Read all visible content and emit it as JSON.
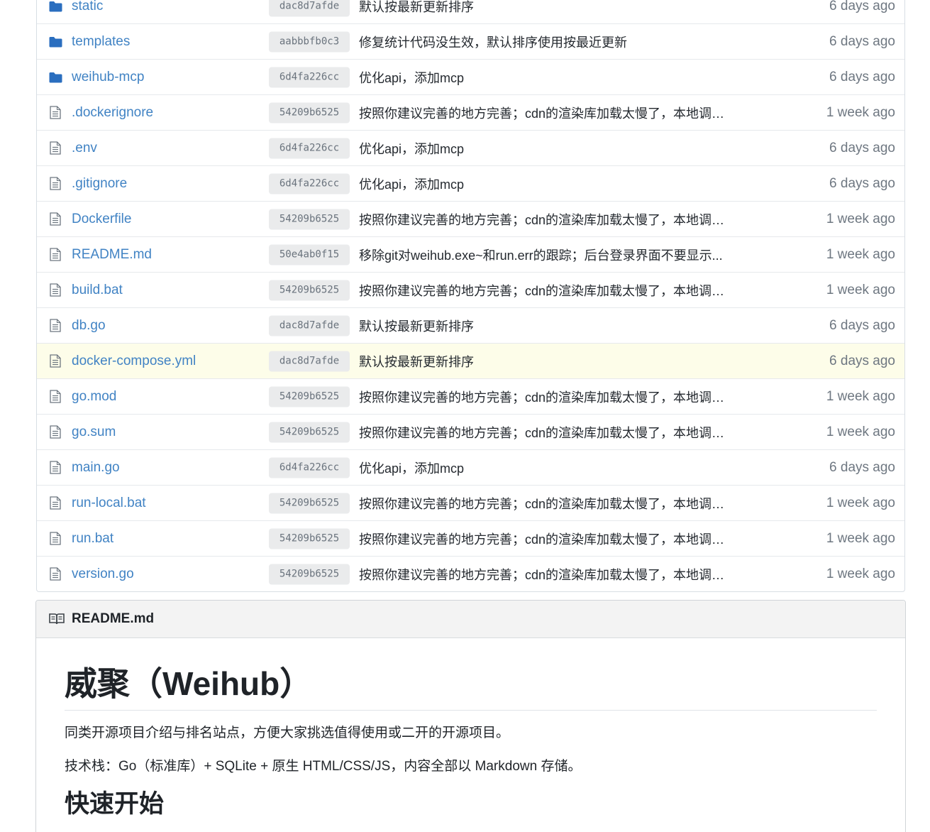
{
  "files": [
    {
      "name": "static",
      "type": "folder",
      "sha": "dac8d7afde",
      "message": "默认按最新更新排序",
      "time": "6 days ago"
    },
    {
      "name": "templates",
      "type": "folder",
      "sha": "aabbbfb0c3",
      "message": "修复统计代码没生效，默认排序使用按最近更新",
      "time": "6 days ago"
    },
    {
      "name": "weihub-mcp",
      "type": "folder",
      "sha": "6d4fa226cc",
      "message": "优化api，添加mcp",
      "time": "6 days ago"
    },
    {
      "name": ".dockerignore",
      "type": "file",
      "sha": "54209b6525",
      "message": "按照你建议完善的地方完善；cdn的渲染库加载太慢了，本地调试...",
      "time": "1 week ago"
    },
    {
      "name": ".env",
      "type": "file",
      "sha": "6d4fa226cc",
      "message": "优化api，添加mcp",
      "time": "6 days ago"
    },
    {
      "name": ".gitignore",
      "type": "file",
      "sha": "6d4fa226cc",
      "message": "优化api，添加mcp",
      "time": "6 days ago"
    },
    {
      "name": "Dockerfile",
      "type": "file",
      "sha": "54209b6525",
      "message": "按照你建议完善的地方完善；cdn的渲染库加载太慢了，本地调试...",
      "time": "1 week ago"
    },
    {
      "name": "README.md",
      "type": "file",
      "sha": "50e4ab0f15",
      "message": "移除git对weihub.exe~和run.err的跟踪；后台登录界面不要显示...",
      "time": "1 week ago"
    },
    {
      "name": "build.bat",
      "type": "file",
      "sha": "54209b6525",
      "message": "按照你建议完善的地方完善；cdn的渲染库加载太慢了，本地调试...",
      "time": "1 week ago"
    },
    {
      "name": "db.go",
      "type": "file",
      "sha": "dac8d7afde",
      "message": "默认按最新更新排序",
      "time": "6 days ago"
    },
    {
      "name": "docker-compose.yml",
      "type": "file",
      "sha": "dac8d7afde",
      "message": "默认按最新更新排序",
      "time": "6 days ago",
      "highlight": true
    },
    {
      "name": "go.mod",
      "type": "file",
      "sha": "54209b6525",
      "message": "按照你建议完善的地方完善；cdn的渲染库加载太慢了，本地调试...",
      "time": "1 week ago"
    },
    {
      "name": "go.sum",
      "type": "file",
      "sha": "54209b6525",
      "message": "按照你建议完善的地方完善；cdn的渲染库加载太慢了，本地调试...",
      "time": "1 week ago"
    },
    {
      "name": "main.go",
      "type": "file",
      "sha": "6d4fa226cc",
      "message": "优化api，添加mcp",
      "time": "6 days ago"
    },
    {
      "name": "run-local.bat",
      "type": "file",
      "sha": "54209b6525",
      "message": "按照你建议完善的地方完善；cdn的渲染库加载太慢了，本地调试...",
      "time": "1 week ago"
    },
    {
      "name": "run.bat",
      "type": "file",
      "sha": "54209b6525",
      "message": "按照你建议完善的地方完善；cdn的渲染库加载太慢了，本地调试...",
      "time": "1 week ago"
    },
    {
      "name": "version.go",
      "type": "file",
      "sha": "54209b6525",
      "message": "按照你建议完善的地方完善；cdn的渲染库加载太慢了，本地调试...",
      "time": "1 week ago"
    }
  ],
  "readme": {
    "header": "README.md",
    "h1": "威聚（Weihub）",
    "p1": "同类开源项目介绍与排名站点，方便大家挑选值得使用或二开的开源项目。",
    "p2": "技术栈：Go（标准库）+ SQLite + 原生 HTML/CSS/JS，内容全部以 Markdown 存储。",
    "h2": "快速开始"
  },
  "colors": {
    "link": "#4183c4",
    "folder_icon": "#2a6ebf",
    "highlight_row": "#fdfde9"
  },
  "icons": {
    "folder": "folder-icon",
    "file": "file-text-icon",
    "readme": "book-icon"
  }
}
